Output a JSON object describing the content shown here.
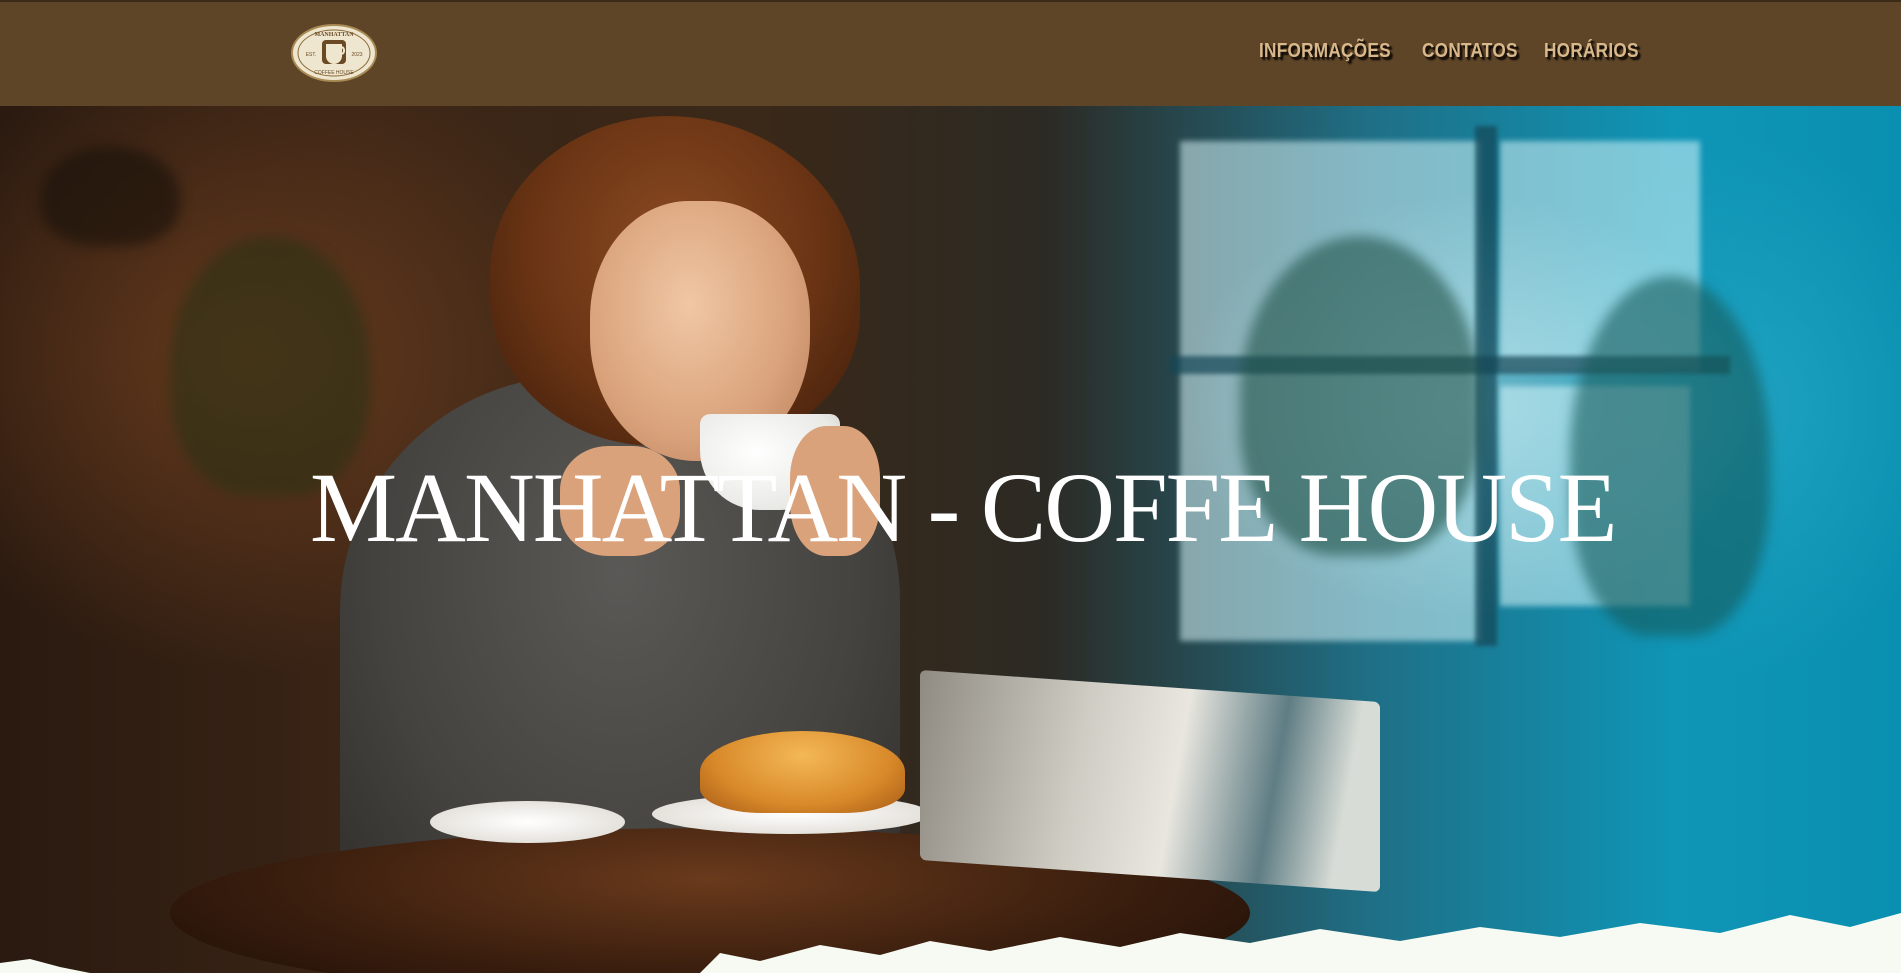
{
  "header": {
    "logo": {
      "icon": "coffee-emblem-icon",
      "top_text": "MANHATTAN",
      "left_text": "EST.",
      "right_text": "2023",
      "bottom_text": "COFFEE HOUSE"
    },
    "nav": [
      {
        "label": "INFORMAÇÕES"
      },
      {
        "label": "CONTATOS"
      },
      {
        "label": "HORÁRIOS"
      }
    ]
  },
  "hero": {
    "title": "MANHATTAN - COFFE HOUSE",
    "image": "woman-drinking-coffee-photo"
  },
  "colors": {
    "header_bg": "#5e4528",
    "nav_text": "#d9b98b",
    "title_text": "#ffffff"
  }
}
